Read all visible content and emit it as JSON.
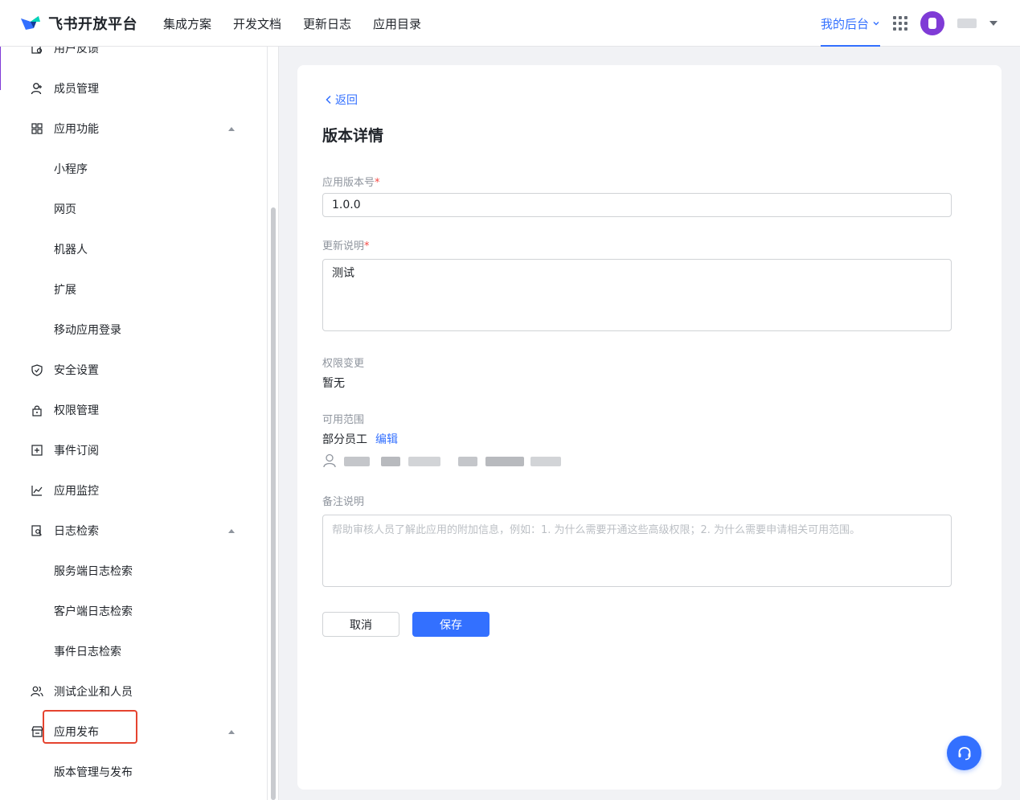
{
  "header": {
    "brand": "飞书开放平台",
    "nav": [
      "集成方案",
      "开发文档",
      "更新日志",
      "应用目录"
    ],
    "my_backend": "我的后台",
    "icons": {
      "apps": "apps-grid-icon",
      "avatar": "avatar",
      "caret": "caret-down-icon"
    }
  },
  "sidebar": {
    "items": [
      {
        "label": "用户反馈",
        "icon": "feedback-icon"
      },
      {
        "label": "成员管理",
        "icon": "user-add-icon"
      },
      {
        "label": "应用功能",
        "icon": "grid-icon",
        "expanded": true
      },
      {
        "label": "小程序"
      },
      {
        "label": "网页"
      },
      {
        "label": "机器人"
      },
      {
        "label": "扩展"
      },
      {
        "label": "移动应用登录"
      },
      {
        "label": "安全设置",
        "icon": "shield-icon"
      },
      {
        "label": "权限管理",
        "icon": "lock-icon"
      },
      {
        "label": "事件订阅",
        "icon": "plus-box-icon"
      },
      {
        "label": "应用监控",
        "icon": "chart-icon"
      },
      {
        "label": "日志检索",
        "icon": "search-doc-icon",
        "expanded": true
      },
      {
        "label": "服务端日志检索"
      },
      {
        "label": "客户端日志检索"
      },
      {
        "label": "事件日志检索"
      },
      {
        "label": "测试企业和人员",
        "icon": "users-icon"
      },
      {
        "label": "应用发布",
        "icon": "store-icon",
        "expanded": true
      },
      {
        "label": "版本管理与发布",
        "active": true
      }
    ]
  },
  "form": {
    "back": "返回",
    "title": "版本详情",
    "version_label": "应用版本号",
    "version_value": "1.0.0",
    "notes_label": "更新说明",
    "notes_value": "测试",
    "perm_label": "权限变更",
    "perm_value": "暂无",
    "scope_label": "可用范围",
    "scope_value": "部分员工",
    "scope_edit": "编辑",
    "remark_label": "备注说明",
    "remark_placeholder": "帮助审核人员了解此应用的附加信息，例如：1. 为什么需要开通这些高级权限；2. 为什么需要申请相关可用范围。",
    "required_mark": "*",
    "cancel": "取消",
    "save": "保存"
  },
  "colors": {
    "accent": "#3370ff",
    "highlight_border": "#e5432f",
    "required": "#f54a45"
  }
}
